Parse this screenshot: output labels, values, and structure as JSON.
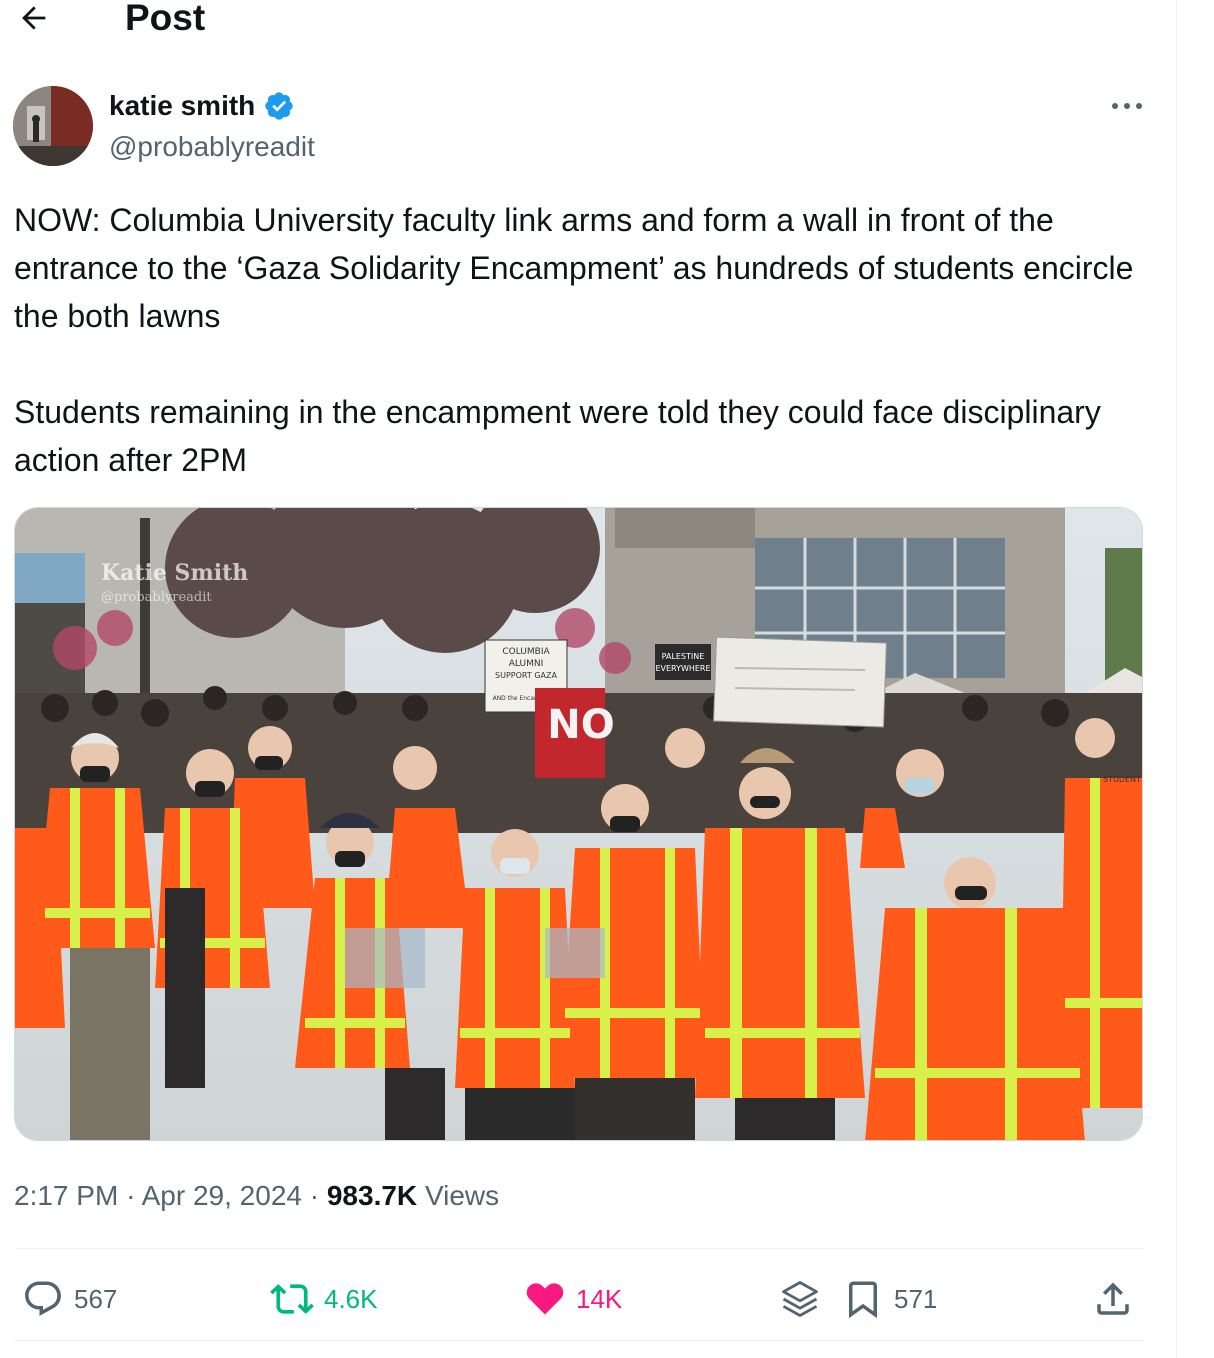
{
  "header": {
    "title": "Post"
  },
  "author": {
    "display_name": "katie smith",
    "handle": "@probablyreadit",
    "verified": true,
    "verified_color": "#1d9bf0"
  },
  "tweet": {
    "text": "NOW: Columbia University faculty link arms and form a wall in front of the entrance to the ‘Gaza Solidarity Encampment’ as hundreds of students encircle the both lawns\n\nStudents remaining in the encampment were told they could face disciplinary action after 2PM"
  },
  "media": {
    "watermark_name": "Katie Smith",
    "watermark_handle": "@probablyreadit",
    "signs": {
      "alumni": [
        "COLUMBIA",
        "ALUMNI",
        "SUPPORT GAZA",
        "AND the Encampment"
      ],
      "palestine": [
        "PALESTINE",
        "EVERYWHERE"
      ],
      "no": "NO",
      "student": "STUDENT"
    }
  },
  "meta": {
    "time": "2:17 PM",
    "separator": "·",
    "date": "Apr 29, 2024",
    "views_count": "983.7K",
    "views_label": "Views"
  },
  "actions": {
    "replies": "567",
    "reposts": "4.6K",
    "likes": "14K",
    "bookmarks": "571"
  },
  "colors": {
    "text": "#0f1419",
    "secondary": "#536471",
    "repost": "#00ba7c",
    "like": "#f91880",
    "verified": "#1d9bf0",
    "vest_orange": "#ff5a1a",
    "vest_stripe": "#d8f04a"
  },
  "icons": [
    "back-arrow-icon",
    "verified-badge-icon",
    "more-icon",
    "reply-icon",
    "repost-icon",
    "like-icon",
    "grok-icon",
    "bookmark-icon",
    "share-icon"
  ]
}
